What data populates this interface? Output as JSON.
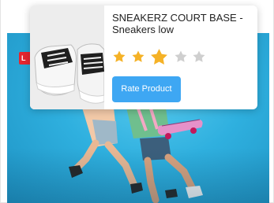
{
  "colors": {
    "accent": "#3ea7f3",
    "star_filled": "#f5b227",
    "star_empty": "#cfcfcf",
    "badge": "#e5262f",
    "hero_bg": "#2fb0df"
  },
  "badge": {
    "text": "L"
  },
  "product": {
    "title": "SNEAKERZ COURT BASE - Sneakers low",
    "image_icon": "sneaker-image"
  },
  "rating": {
    "value": 3,
    "max": 5,
    "hovered_star": 3
  },
  "rate_button": {
    "label": "Rate Product"
  }
}
